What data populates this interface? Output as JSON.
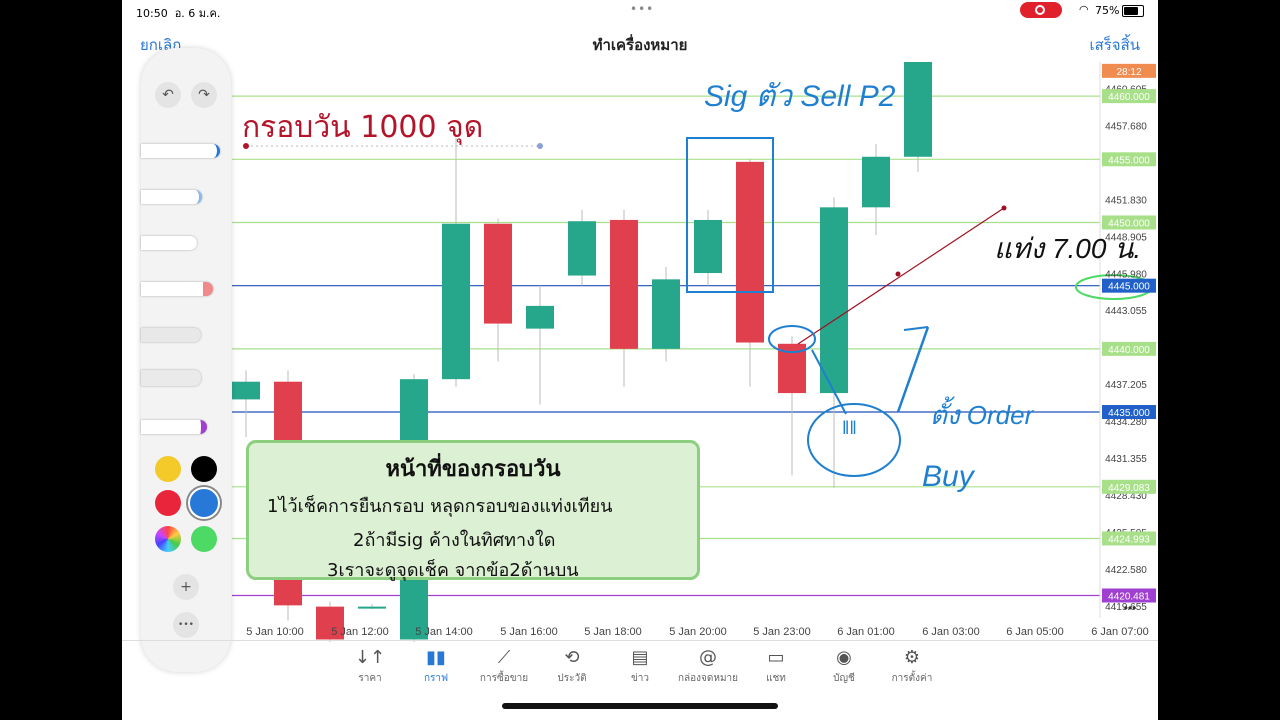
{
  "status": {
    "time": "10:50",
    "date": "อ. 6 ม.ค.",
    "battery": "75%"
  },
  "nav": {
    "cancel": "ยกเลิก",
    "title": "ทำเครื่องหมาย",
    "done": "เสร็จสิ้น"
  },
  "heading": "กรอบวัน 1000 จุด",
  "note": {
    "title": "หน้าที่ของกรอบวัน",
    "lines": [
      "1ไว้เช็คการยืนกรอบ หลุดกรอบของแท่งเทียน",
      "2ถ้ามีsig ค้างในทิศทางใด",
      "3เราจะดูจุดเช็ค จากข้อ2ด้านบน"
    ]
  },
  "handwriting": {
    "sig": "Sig ตัว Sell P2",
    "bar": "แท่ง 7.00 น.",
    "order": "ตั้ง Order",
    "buy": "Buy"
  },
  "price_scale": {
    "tags": [
      {
        "label": "28:12",
        "price": 4462.0,
        "color": "#f08c50"
      },
      {
        "label": "4460.000",
        "price": 4460.0,
        "color": "#a8e08a"
      },
      {
        "label": "4455.000",
        "price": 4455.0,
        "color": "#a8e08a"
      },
      {
        "label": "4450.000",
        "price": 4450.0,
        "color": "#a8e08a"
      },
      {
        "label": "4445.000",
        "price": 4445.0,
        "color": "#2060c8"
      },
      {
        "label": "4440.000",
        "price": 4440.0,
        "color": "#a8e08a"
      },
      {
        "label": "4435.000",
        "price": 4435.0,
        "color": "#2060c8"
      },
      {
        "label": "4429.083",
        "price": 4429.083,
        "color": "#a8e08a"
      },
      {
        "label": "4424.993",
        "price": 4424.993,
        "color": "#a8e08a"
      },
      {
        "label": "4420.481",
        "price": 4420.481,
        "color": "#a040d0"
      }
    ],
    "ticks": [
      "4460.605",
      "4457.680",
      "4451.830",
      "4448.905",
      "4445.980",
      "4443.055",
      "4437.205",
      "4434.280",
      "4431.355",
      "4428.430",
      "4425.505",
      "4422.580",
      "4419.655"
    ],
    "tick_values": [
      4460.605,
      4457.68,
      4451.83,
      4448.905,
      4445.98,
      4443.055,
      4437.205,
      4434.28,
      4431.355,
      4428.43,
      4425.505,
      4422.58,
      4419.655
    ],
    "more": "•••"
  },
  "chart_data": {
    "type": "candlestick",
    "ylim": [
      4418.7,
      4462.7
    ],
    "lines": [
      {
        "price": 4460.0,
        "color": "#a8e08a"
      },
      {
        "price": 4455.0,
        "color": "#a8e08a"
      },
      {
        "price": 4450.0,
        "color": "#a8e08a"
      },
      {
        "price": 4445.0,
        "color": "#2050b8"
      },
      {
        "price": 4440.0,
        "color": "#a8e08a"
      },
      {
        "price": 4435.0,
        "color": "#2050b8"
      },
      {
        "price": 4429.083,
        "color": "#a8e08a"
      },
      {
        "price": 4424.993,
        "color": "#a8e08a"
      },
      {
        "price": 4420.481,
        "color": "#a040d0"
      }
    ],
    "x_labels": [
      "5 Jan 10:00",
      "5 Jan 12:00",
      "5 Jan 14:00",
      "5 Jan 16:00",
      "5 Jan 18:00",
      "5 Jan 20:00",
      "5 Jan 23:00",
      "6 Jan 01:00",
      "6 Jan 03:00",
      "6 Jan 05:00",
      "6 Jan 07:00"
    ],
    "candles": [
      {
        "o": 4436.0,
        "c": 4437.4,
        "h": 4438.3,
        "l": 4433.0
      },
      {
        "o": 4437.4,
        "c": 4419.7,
        "h": 4438.3,
        "l": 4418.5
      },
      {
        "o": 4419.6,
        "c": 4417.0,
        "h": 4420.0,
        "l": 4416.0
      },
      {
        "o": 4419.6,
        "c": 4419.6,
        "h": 4419.8,
        "l": 4419.4
      },
      {
        "o": 4417.0,
        "c": 4437.6,
        "h": 4438.0,
        "l": 4416.0
      },
      {
        "o": 4437.6,
        "c": 4449.9,
        "h": 4456.7,
        "l": 4437.0
      },
      {
        "o": 4449.9,
        "c": 4442.0,
        "h": 4450.3,
        "l": 4439.0
      },
      {
        "o": 4441.6,
        "c": 4443.4,
        "h": 4445.0,
        "l": 4435.6
      },
      {
        "o": 4445.8,
        "c": 4450.1,
        "h": 4451.0,
        "l": 4445.0
      },
      {
        "o": 4450.2,
        "c": 4440.0,
        "h": 4451.0,
        "l": 4437.0
      },
      {
        "o": 4440.0,
        "c": 4445.5,
        "h": 4446.5,
        "l": 4439.0
      },
      {
        "o": 4446.0,
        "c": 4450.2,
        "h": 4451.0,
        "l": 4445.0
      },
      {
        "o": 4454.8,
        "c": 4440.5,
        "h": 4455.0,
        "l": 4437.0
      },
      {
        "o": 4440.4,
        "c": 4436.5,
        "h": 4441.0,
        "l": 4430.0
      },
      {
        "o": 4436.5,
        "c": 4451.2,
        "h": 4452.0,
        "l": 4429.0
      },
      {
        "o": 4451.2,
        "c": 4455.2,
        "h": 4456.2,
        "l": 4449.0
      },
      {
        "o": 4455.2,
        "c": 4464.0,
        "h": 4464.0,
        "l": 4454.0
      }
    ]
  },
  "tabs": [
    {
      "label": "ราคา",
      "icon": "↓↑"
    },
    {
      "label": "กราฟ",
      "icon": "▮▮"
    },
    {
      "label": "การซื้อขาย",
      "icon": "⟋"
    },
    {
      "label": "ประวัติ",
      "icon": "⟲"
    },
    {
      "label": "ข่าว",
      "icon": "▤"
    },
    {
      "label": "กล่องจดหมาย",
      "icon": "@"
    },
    {
      "label": "แชท",
      "icon": "▭"
    },
    {
      "label": "บัญชี",
      "icon": "◉"
    },
    {
      "label": "การตั้งค่า",
      "icon": "⚙"
    }
  ],
  "palette": {
    "undo": "↶",
    "redo": "↷",
    "add": "+",
    "more": "•••",
    "colors": [
      "#f4c92a",
      "#000000",
      "#e8253a",
      "#2878d8",
      "#ffffff",
      "#4cd964"
    ]
  }
}
